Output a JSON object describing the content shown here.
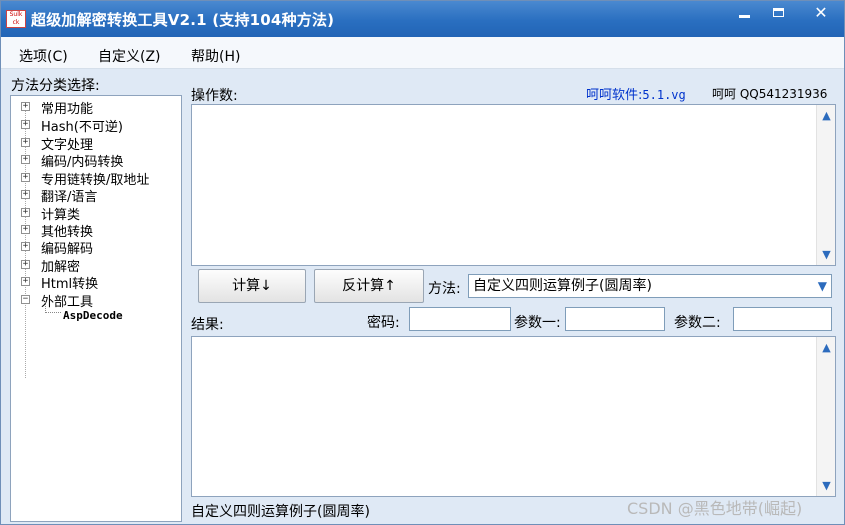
{
  "window": {
    "title": "超级加解密转换工具V2.1 (支持104种方法)",
    "logo_text_top": "Sulk",
    "logo_text_bottom": "ck"
  },
  "menu": {
    "items": [
      {
        "label": "选项(C)"
      },
      {
        "label": "自定义(Z)"
      },
      {
        "label": "帮助(H)"
      }
    ]
  },
  "sidebar": {
    "label": "方法分类选择:",
    "categories": [
      {
        "label": "常用功能",
        "expander": "+"
      },
      {
        "label": "Hash(不可逆)",
        "expander": "+"
      },
      {
        "label": "文字处理",
        "expander": "+"
      },
      {
        "label": "编码/内码转换",
        "expander": "+"
      },
      {
        "label": "专用链转换/取地址",
        "expander": "+"
      },
      {
        "label": "翻译/语言",
        "expander": "+"
      },
      {
        "label": "计算类",
        "expander": "+"
      },
      {
        "label": "其他转换",
        "expander": "+"
      },
      {
        "label": "编码解码",
        "expander": "+"
      },
      {
        "label": "加解密",
        "expander": "+"
      },
      {
        "label": "Html转换",
        "expander": "+"
      },
      {
        "label": "外部工具",
        "expander": "−"
      }
    ],
    "sub_item": "AspDecode"
  },
  "main": {
    "operand_label": "操作数:",
    "brand_name": "呵呵软件:",
    "brand_version": "5.1.vg",
    "qq_text": "呵呵 QQ541231936",
    "calc_button": "计算↓",
    "reverse_calc_button": "反计算↑",
    "method_label": "方法:",
    "method_value": "自定义四则运算例子(圆周率)",
    "result_label": "结果:",
    "password_label": "密码:",
    "param1_label": "参数一:",
    "param2_label": "参数二:",
    "password_value": "",
    "param1_value": "",
    "param2_value": ""
  },
  "status": {
    "text": "自定义四则运算例子(圆周率)"
  },
  "watermark": "CSDN @黑色地带(崛起)",
  "colors": {
    "titlebar": "#2a6fc0",
    "brand_link": "#0033cc",
    "scroll_arrow": "#2c6bbd"
  }
}
